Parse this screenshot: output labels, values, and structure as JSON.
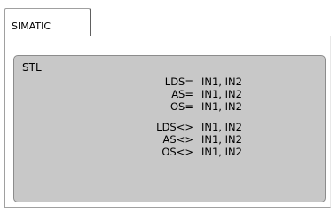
{
  "tab": {
    "label": "SIMATIC"
  },
  "group": {
    "title": "STL",
    "rows": [
      {
        "op": "LDS=",
        "args": "IN1, IN2"
      },
      {
        "op": "AS=",
        "args": "IN1, IN2"
      },
      {
        "op": "OS=",
        "args": "IN1, IN2"
      },
      {
        "op": "LDS<>",
        "args": "IN1, IN2"
      },
      {
        "op": "AS<>",
        "args": "IN1, IN2"
      },
      {
        "op": "OS<>",
        "args": "IN1, IN2"
      }
    ]
  }
}
